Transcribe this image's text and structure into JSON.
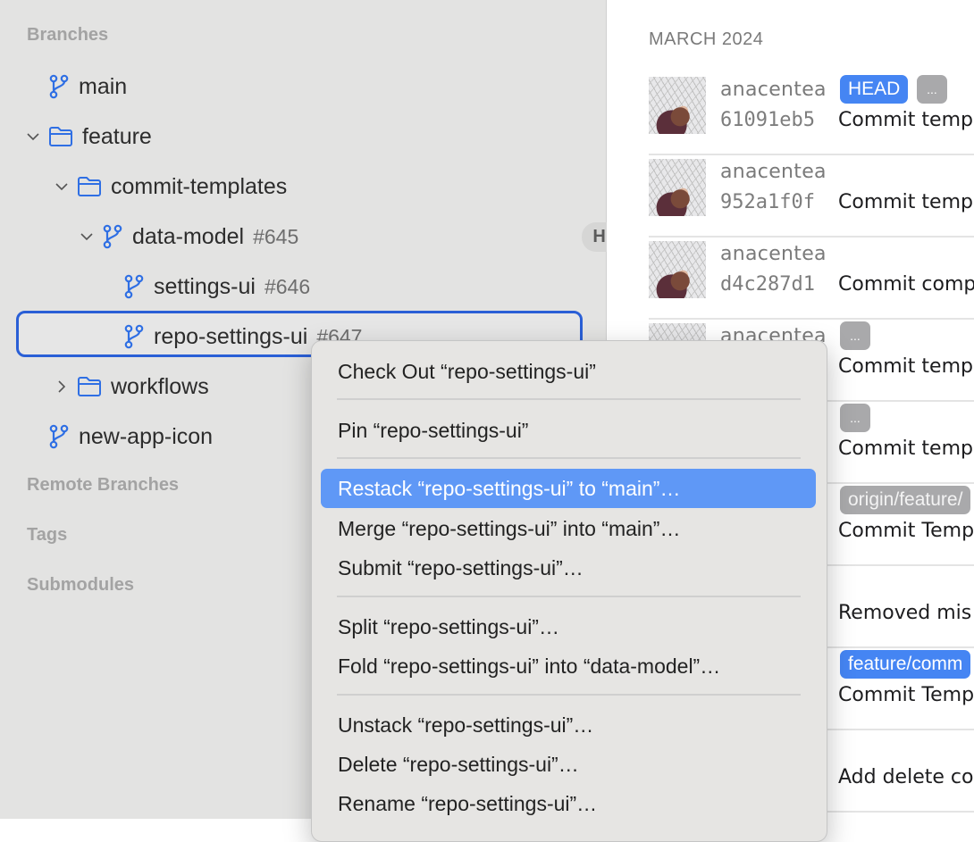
{
  "sidebar": {
    "sections": {
      "branches": "Branches",
      "remote_branches": "Remote Branches",
      "tags": "Tags",
      "submodules": "Submodules"
    },
    "tree": [
      {
        "label": "main",
        "type": "branch",
        "level": 0
      },
      {
        "label": "feature",
        "type": "folder",
        "level": 0,
        "expanded": true
      },
      {
        "label": "commit-templates",
        "type": "folder",
        "level": 1,
        "expanded": true
      },
      {
        "label": "data-model",
        "pr": "#645",
        "type": "branch",
        "level": 2,
        "expanded": true,
        "badge": "HEAD"
      },
      {
        "label": "settings-ui",
        "pr": "#646",
        "type": "branch",
        "level": 3,
        "status_icon": "stack-warning-icon"
      },
      {
        "label": "repo-settings-ui",
        "pr": "#647",
        "type": "branch",
        "level": 3,
        "status_icon": "stack-warning-icon",
        "selected": true
      },
      {
        "label": "workflows",
        "type": "folder",
        "level": 1,
        "expanded": false
      },
      {
        "label": "new-app-icon",
        "type": "branch",
        "level": 0
      }
    ]
  },
  "history": {
    "month": "MARCH 2024",
    "commits": [
      {
        "author": "anacentea",
        "sha": "61091eb5",
        "message": "Commit temp",
        "tags": [
          "HEAD",
          "..."
        ]
      },
      {
        "author": "anacentea",
        "sha": "952a1f0f",
        "message": "Commit temp",
        "tags": []
      },
      {
        "author": "anacentea",
        "sha": "d4c287d1",
        "message": "Commit comp",
        "tags": []
      },
      {
        "author": "anacentea",
        "sha": "",
        "message": "Commit temp",
        "tags": [
          "..."
        ]
      },
      {
        "author": "",
        "sha": "",
        "message": "Commit temp",
        "tags": [
          "..."
        ]
      },
      {
        "author": "",
        "sha": "",
        "message": "Commit Temp",
        "tags": [
          "origin/feature/"
        ]
      },
      {
        "author": "",
        "sha": "",
        "message": "Removed mis",
        "tags": []
      },
      {
        "author": "",
        "sha": "",
        "message": "Commit Temp",
        "tags": [
          "feature/comm"
        ]
      },
      {
        "author": "",
        "sha": "",
        "message": "Add delete co",
        "tags": []
      }
    ]
  },
  "context_menu": {
    "items": [
      {
        "label": "Check Out “repo-settings-ui”"
      },
      {
        "label": "Pin “repo-settings-ui”"
      },
      {
        "label": "Restack “repo-settings-ui” to “main”…",
        "highlighted": true
      },
      {
        "label": "Merge “repo-settings-ui” into “main”…"
      },
      {
        "label": "Submit “repo-settings-ui”…"
      },
      {
        "label": "Split “repo-settings-ui”…"
      },
      {
        "label": "Fold “repo-settings-ui” into “data-model”…"
      },
      {
        "label": "Unstack “repo-settings-ui”…"
      },
      {
        "label": "Delete “repo-settings-ui”…"
      },
      {
        "label": "Rename “repo-settings-ui”…"
      }
    ]
  },
  "colors": {
    "accent": "#4585f3",
    "selection_border": "#2a5fd6",
    "menu_highlight": "#5f98f6",
    "sidebar_bg": "#e3e3e2"
  }
}
